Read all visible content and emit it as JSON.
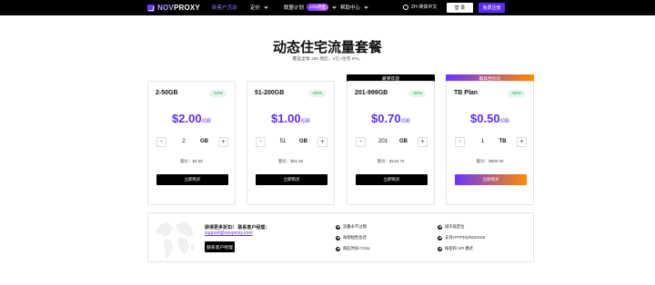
{
  "nav": {
    "logo": "NOVPROXY",
    "logo_prefix": "NOV",
    "logo_suffix": "PROXY",
    "links": [
      {
        "label": "新客户活动",
        "active": true
      },
      {
        "label": "定价",
        "active": false
      },
      {
        "label": "联盟计划",
        "badge": "10%佣金",
        "active": false
      },
      {
        "label": "帮助中心",
        "active": false
      }
    ],
    "language": "ZH-简体中文",
    "login": "登 录",
    "register": "免费注册"
  },
  "hero": {
    "title": "动态住宅流量套餐",
    "subtitle": "覆盖全球 190 地区，1亿+住宅 IPs。"
  },
  "plans": [
    {
      "name": "2-50GB",
      "discount": "-10%",
      "price": "$2.00",
      "unit": "/GB",
      "qty": "2",
      "qty_unit": "GB",
      "total": "套价：$4.00",
      "buy": "立即购买",
      "banner": ""
    },
    {
      "name": "51-200GB",
      "discount": "-20%",
      "price": "$1.00",
      "unit": "/GB",
      "qty": "51",
      "qty_unit": "GB",
      "total": "套价：$51.00",
      "buy": "立即购买",
      "banner": ""
    },
    {
      "name": "201-999GB",
      "discount": "-45%",
      "price": "$0.70",
      "unit": "/GB",
      "qty": "201",
      "qty_unit": "GB",
      "total": "套价：$140.70",
      "buy": "立即购买",
      "banner": "最受欢迎"
    },
    {
      "name": "TB Plan",
      "discount": "-50%",
      "price": "$0.50",
      "unit": "/GB",
      "qty": "1",
      "qty_unit": "TB",
      "total": "套价：$500.00",
      "buy": "立即购买",
      "banner": "最具性价比"
    }
  ],
  "stepper": {
    "minus": "-",
    "plus": "+"
  },
  "contact": {
    "title": "获得更多折扣！ 联系客户经理：",
    "email": "support@novproxy.com",
    "button": "联系客户经理"
  },
  "features": [
    "流量永不过期",
    "城市级定位",
    "每把粘性会话",
    "支持HTTP(S)/SOCKS5",
    "响应时间＜0.5s",
    "账密和 API 模式"
  ],
  "colors": {
    "brand": "#5d2bff",
    "success": "#2c9a55",
    "gradient_start": "#6a35ff",
    "gradient_end": "#ff8a00"
  }
}
